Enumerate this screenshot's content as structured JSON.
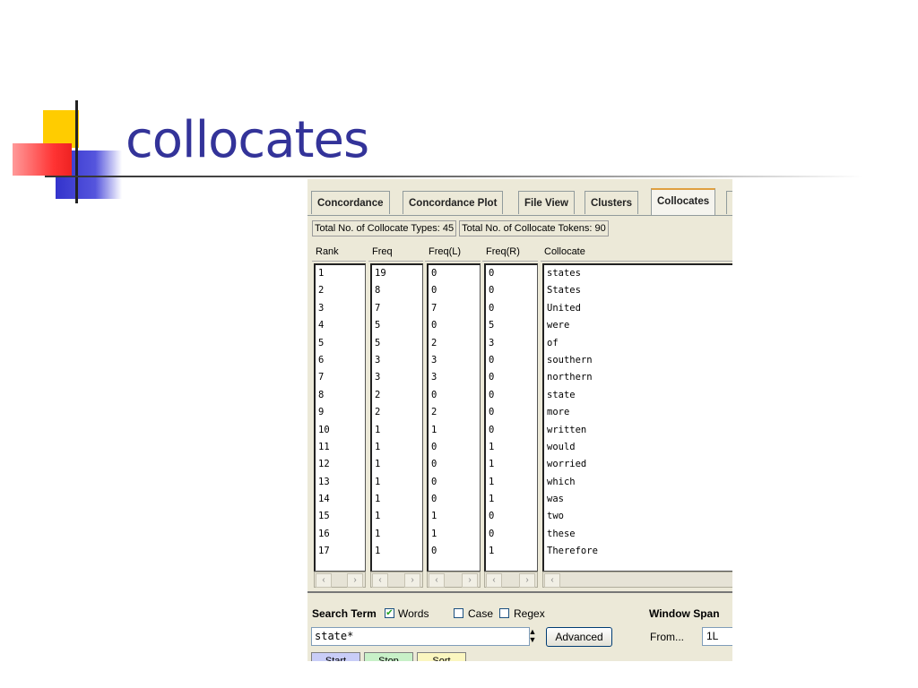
{
  "slide": {
    "title": "collocates"
  },
  "tabs": [
    {
      "label": "Concordance"
    },
    {
      "label": "Concordance Plot"
    },
    {
      "label": "File View"
    },
    {
      "label": "Clusters"
    },
    {
      "label": "Collocates"
    }
  ],
  "stats": {
    "types": "Total No. of Collocate Types: 45",
    "tokens": "Total No. of Collocate Tokens: 90"
  },
  "columns": {
    "rank": "Rank",
    "freq": "Freq",
    "freq_l": "Freq(L)",
    "freq_r": "Freq(R)",
    "collocate": "Collocate"
  },
  "rows": [
    {
      "rank": "1",
      "freq": "19",
      "l": "0",
      "r": "0",
      "word": "states"
    },
    {
      "rank": "2",
      "freq": "8",
      "l": "0",
      "r": "0",
      "word": "States"
    },
    {
      "rank": "3",
      "freq": "7",
      "l": "7",
      "r": "0",
      "word": "United"
    },
    {
      "rank": "4",
      "freq": "5",
      "l": "0",
      "r": "5",
      "word": "were"
    },
    {
      "rank": "5",
      "freq": "5",
      "l": "2",
      "r": "3",
      "word": "of"
    },
    {
      "rank": "6",
      "freq": "3",
      "l": "3",
      "r": "0",
      "word": "southern"
    },
    {
      "rank": "7",
      "freq": "3",
      "l": "3",
      "r": "0",
      "word": "northern"
    },
    {
      "rank": "8",
      "freq": "2",
      "l": "0",
      "r": "0",
      "word": "state"
    },
    {
      "rank": "9",
      "freq": "2",
      "l": "2",
      "r": "0",
      "word": "more"
    },
    {
      "rank": "10",
      "freq": "1",
      "l": "1",
      "r": "0",
      "word": "written"
    },
    {
      "rank": "11",
      "freq": "1",
      "l": "0",
      "r": "1",
      "word": "would"
    },
    {
      "rank": "12",
      "freq": "1",
      "l": "0",
      "r": "1",
      "word": "worried"
    },
    {
      "rank": "13",
      "freq": "1",
      "l": "0",
      "r": "1",
      "word": "which"
    },
    {
      "rank": "14",
      "freq": "1",
      "l": "0",
      "r": "1",
      "word": "was"
    },
    {
      "rank": "15",
      "freq": "1",
      "l": "1",
      "r": "0",
      "word": "two"
    },
    {
      "rank": "16",
      "freq": "1",
      "l": "1",
      "r": "0",
      "word": "these"
    },
    {
      "rank": "17",
      "freq": "1",
      "l": "0",
      "r": "1",
      "word": "Therefore"
    }
  ],
  "search": {
    "label": "Search Term",
    "words_label": "Words",
    "words_checked": true,
    "case_label": "Case",
    "case_checked": false,
    "regex_label": "Regex",
    "regex_checked": false,
    "value": "state*",
    "advanced_label": "Advanced"
  },
  "window_span": {
    "label": "Window Span",
    "from_label": "From...",
    "from_value": "1L"
  },
  "buttons": {
    "start": "Start",
    "stop": "Stop",
    "sort": "Sort"
  },
  "colors": {
    "title": "#333399",
    "start_btn": "#c9cdf7",
    "stop_btn": "#c8f0c8",
    "sort_btn": "#fbf6c0"
  }
}
